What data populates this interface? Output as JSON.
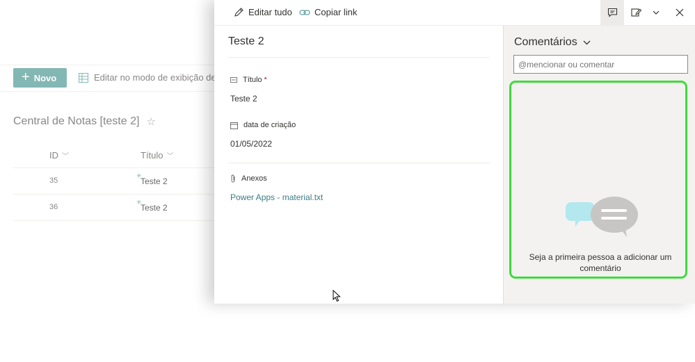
{
  "toolbar": {
    "edit_all_label": "Editar tudo",
    "copy_link_label": "Copiar link"
  },
  "list_page": {
    "new_button_label": "Novo",
    "grid_edit_label": "Editar no modo de exibição de g",
    "list_title": "Central de Notas [teste 2]",
    "columns": [
      "ID",
      "Título"
    ],
    "rows": [
      {
        "id": "35",
        "title": "Teste 2"
      },
      {
        "id": "36",
        "title": "Teste 2"
      }
    ]
  },
  "item_form": {
    "title": "Teste 2",
    "fields": {
      "titulo_label": "Título",
      "titulo_required_mark": "*",
      "titulo_value": "Teste 2",
      "data_label": "data de criação",
      "data_value": "01/05/2022",
      "anexos_label": "Anexos",
      "anexo_file": "Power Apps - material.txt"
    }
  },
  "comments": {
    "title": "Comentários",
    "input_placeholder": "@mencionar ou comentar",
    "empty_text": "Seja a primeira pessoa a adicionar um comentário"
  },
  "colors": {
    "accent": "#5a9f9b",
    "link": "#3c7d85",
    "highlight": "#3ddc3b"
  },
  "icons": [
    "pencil-icon",
    "link-icon",
    "comment-icon",
    "edit-form-icon",
    "chevron-down-icon",
    "close-icon",
    "grid-icon",
    "star-icon",
    "text-field-icon",
    "calendar-icon",
    "paperclip-icon",
    "chat-bubbles-icon",
    "mouse-cursor-icon"
  ]
}
